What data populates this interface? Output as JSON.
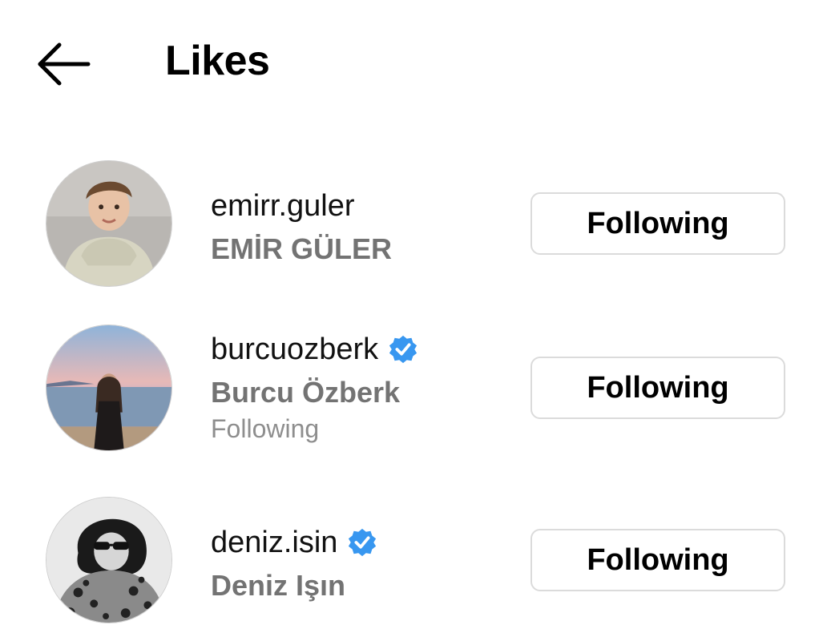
{
  "header": {
    "title": "Likes",
    "back_icon": "arrow-left-icon"
  },
  "users": [
    {
      "username": "emirr.guler",
      "full_name": "EMİR GÜLER",
      "verified": false,
      "subtitle": "",
      "button_label": "Following"
    },
    {
      "username": "burcuozberk",
      "full_name": "Burcu Özberk",
      "verified": true,
      "subtitle": "Following",
      "button_label": "Following"
    },
    {
      "username": "deniz.isin",
      "full_name": "Deniz Işın",
      "verified": true,
      "subtitle": "",
      "button_label": "Following"
    }
  ],
  "colors": {
    "verified_blue": "#3897f0",
    "secondary_text": "#737373",
    "button_border": "#dbdbdb"
  }
}
